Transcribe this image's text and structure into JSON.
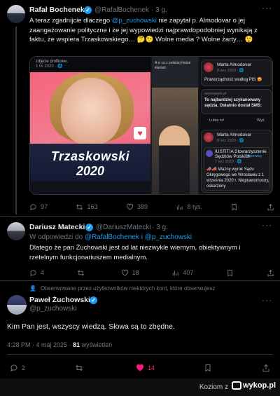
{
  "tweet1": {
    "name": "Rafał Bochenek",
    "handle": "@RafalBochenek",
    "time": "· 3 g.",
    "text_a": "A teraz zgadnijcie dlaczego ",
    "mention": "@p_zuchowski",
    "text_b": " nie zapytał p. Almodovar o jej zaangażowanie polityczne i że jej wypowiedzi najprawdopodobniej wynikają z faktu, że wspiera Trzaskowskiego… 🤔🤨 Wolne media ? Wolne żarty… 😲",
    "media": {
      "left_header": "zdjęcie profilowe.",
      "left_date": "1 lis 2020 · 🌐",
      "poster_name": "Trzaskowski",
      "poster_year": "2020",
      "mid_text": "A ci co z polskiej histori kłamali",
      "card1_name": "Marta Almodovar",
      "card1_date": "8 wrz 2020 · 🌐",
      "card1_text": "Praworządność według PIS 😡",
      "link_domain": "newsweek.pl",
      "link_title": "To najbardziej szykanowany sędzia. Ostatnio dostał SMS: „Wyp*r…",
      "like_label": "Lubię to!",
      "share_label": "Wyś",
      "card2_name": "Marta Almodovar",
      "card2_date": "8 wrz 2020 · 🌐",
      "card3_name": "IUSTITIA Stowarzyszenie Sędziów Polskich",
      "card3_follow": "· Obserwuj",
      "card3_date": "7 wrz 2020 · 🌐",
      "card3_text": "📣📣 Ważny wyrok Sądu Okręgowego we Wrocławiu z 1 września 2020 r. Nieprawomocny, oskarżony"
    },
    "stats": {
      "replies": "97",
      "reposts": "163",
      "likes": "389",
      "views": "8 tys."
    }
  },
  "tweet2": {
    "name": "Dariusz Matecki",
    "handle": "@DariuszMatecki",
    "time": "· 3 g.",
    "reply_prefix": "W odpowiedzi do ",
    "reply_to": "@RafalBochenek i @p_zuchowski",
    "text": "Dlatego że pan Żuchowski jest od lat niezwykle wiernym, obiektywnym i rzetelnym funkcjonariuszem medialnym.",
    "stats": {
      "replies": "4",
      "reposts": "",
      "likes": "18",
      "views": "407"
    }
  },
  "tweet3": {
    "context": "Obserwowane przez użytkowników niektórych kont, które obserwujesz",
    "name": "Paweł Żuchowski",
    "handle": "@p_zuchowski",
    "text": "Kim Pan jest, wszyscy wiedzą. Słowa są to zbędne.",
    "time": "4:28 PM · 4 maj 2025 · ",
    "views_count": "81",
    "views_label": " wyświetleń",
    "stats": {
      "replies": "2",
      "reposts": "",
      "likes": "14"
    }
  },
  "footer": {
    "watermark_text": "Koziom  z",
    "logo": "wykop.pl"
  },
  "colors": {
    "accent": "#1d9bf0",
    "like": "#f91880",
    "muted": "#71767b"
  }
}
